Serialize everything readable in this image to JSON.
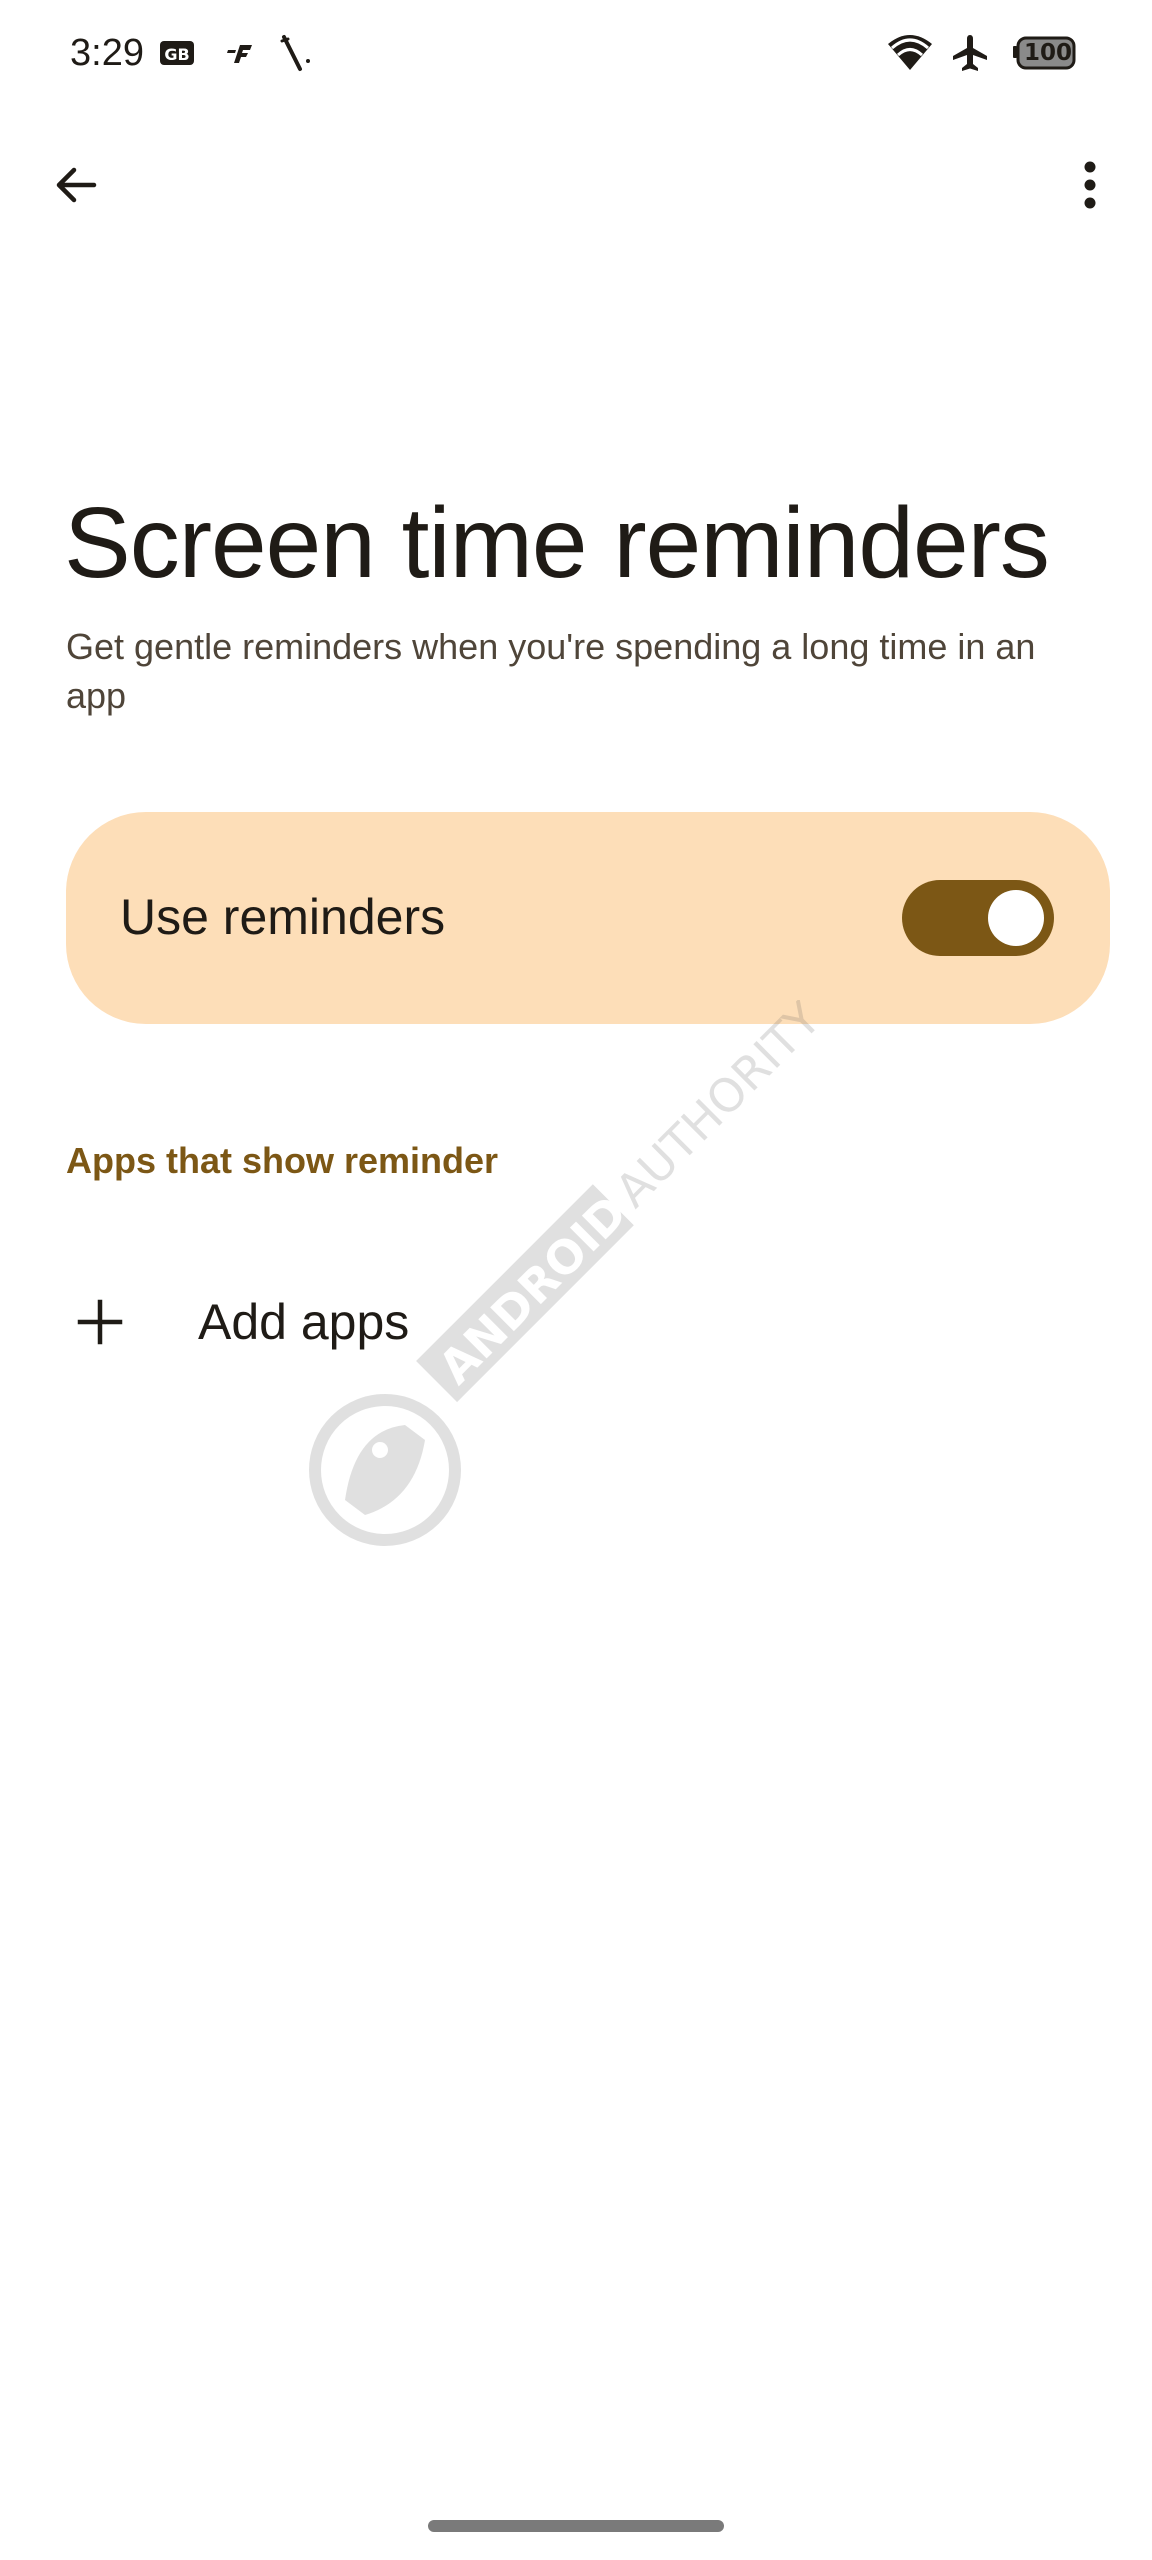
{
  "status_bar": {
    "time": "3:29",
    "battery": "100",
    "icons": [
      "gb-icon",
      "f-icon",
      "slash-icon",
      "wifi-icon",
      "airplane-icon",
      "battery-icon"
    ]
  },
  "top_bar": {
    "back_icon": "arrow-back-icon",
    "more_icon": "more-vert-icon"
  },
  "page": {
    "title": "Screen time reminders",
    "description": "Get gentle reminders when you're spending a long time in an app"
  },
  "reminder_card": {
    "label": "Use reminders",
    "toggle_on": true
  },
  "apps_section": {
    "header": "Apps that show reminder",
    "add_label": "Add apps",
    "add_icon": "plus-icon"
  },
  "watermark": {
    "text": "ANDROID AUTHORITY"
  },
  "colors": {
    "accent": "#7c5715",
    "card_bg": "#fddeb8",
    "text_primary": "#1f1b16",
    "text_secondary": "#4f4539",
    "background": "#ffffff"
  }
}
